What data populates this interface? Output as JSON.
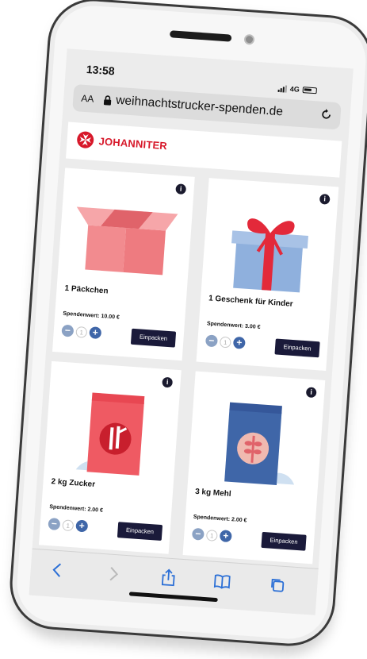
{
  "status": {
    "time": "13:58",
    "network": "4G"
  },
  "browser": {
    "text_size": "AA",
    "url": "weihnachtstrucker-spenden.de"
  },
  "brand": {
    "name": "JOHANNITER",
    "color": "#d7182a"
  },
  "products": [
    {
      "name": "1 Päckchen",
      "value_label": "Spendenwert: 10.00 €",
      "qty": "1",
      "button": "Einpacken",
      "icon": "box-icon"
    },
    {
      "name": "1 Geschenk für Kinder",
      "value_label": "Spendenwert: 3.00 €",
      "qty": "1",
      "button": "Einpacken",
      "icon": "gift-icon"
    },
    {
      "name": "2 kg Zucker",
      "value_label": "Spendenwert: 2.00 €",
      "qty": "1",
      "button": "Einpacken",
      "icon": "sugar-bag-icon"
    },
    {
      "name": "3 kg Mehl",
      "value_label": "Spendenwert: 2.00 €",
      "qty": "1",
      "button": "Einpacken",
      "icon": "flour-bag-icon"
    }
  ],
  "stepper": {
    "minus": "−",
    "plus": "+"
  },
  "info_glyph": "i",
  "colors": {
    "navy_button": "#1a1a3a",
    "stepper_minus": "#8ba2c4",
    "stepper_plus": "#3f66a8",
    "box_pink": "#f28b8f",
    "gift_blue": "#8fb0dd",
    "ribbon_red": "#e3293a"
  }
}
